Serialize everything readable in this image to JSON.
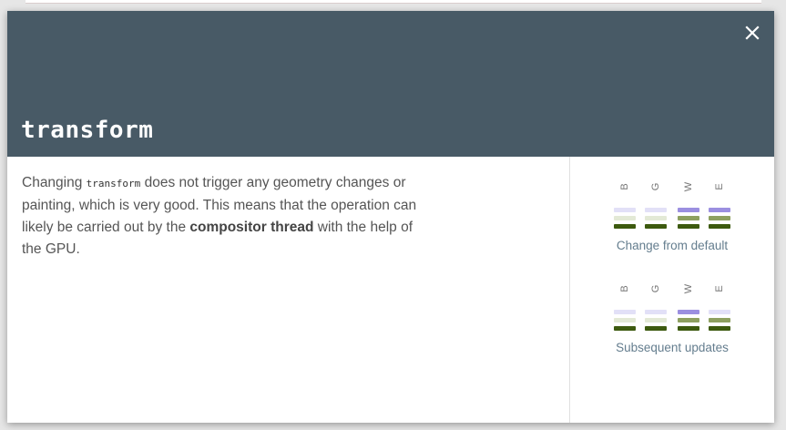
{
  "title": "transform",
  "description": {
    "text_before_code": "Changing ",
    "code": "transform",
    "text_after_code": " does not trigger any geometry changes or painting, which is very good. This means that the operation can likely be carried out by the ",
    "strong": "compositor thread",
    "text_end": " with the help of the GPU."
  },
  "engines": [
    "B",
    "G",
    "W",
    "E"
  ],
  "colors": {
    "header_bg": "#485a66",
    "layout_active": "#9b8fe0",
    "layout_inactive": "#e2e0f7",
    "paint_active": "#8ea060",
    "paint_inactive": "#e3e9d6",
    "composite_active": "#3d5a0f",
    "label": "#647d8e"
  },
  "groups": [
    {
      "label": "Change from default",
      "bars": [
        {
          "engine": "B",
          "layout": false,
          "paint": false,
          "composite": true
        },
        {
          "engine": "G",
          "layout": false,
          "paint": false,
          "composite": true
        },
        {
          "engine": "W",
          "layout": true,
          "paint": true,
          "composite": true
        },
        {
          "engine": "E",
          "layout": true,
          "paint": true,
          "composite": true
        }
      ]
    },
    {
      "label": "Subsequent updates",
      "bars": [
        {
          "engine": "B",
          "layout": false,
          "paint": false,
          "composite": true
        },
        {
          "engine": "G",
          "layout": false,
          "paint": false,
          "composite": true
        },
        {
          "engine": "W",
          "layout": true,
          "paint": true,
          "composite": true
        },
        {
          "engine": "E",
          "layout": false,
          "paint": true,
          "composite": true
        }
      ]
    }
  ],
  "icons": {
    "close": "close-icon"
  }
}
